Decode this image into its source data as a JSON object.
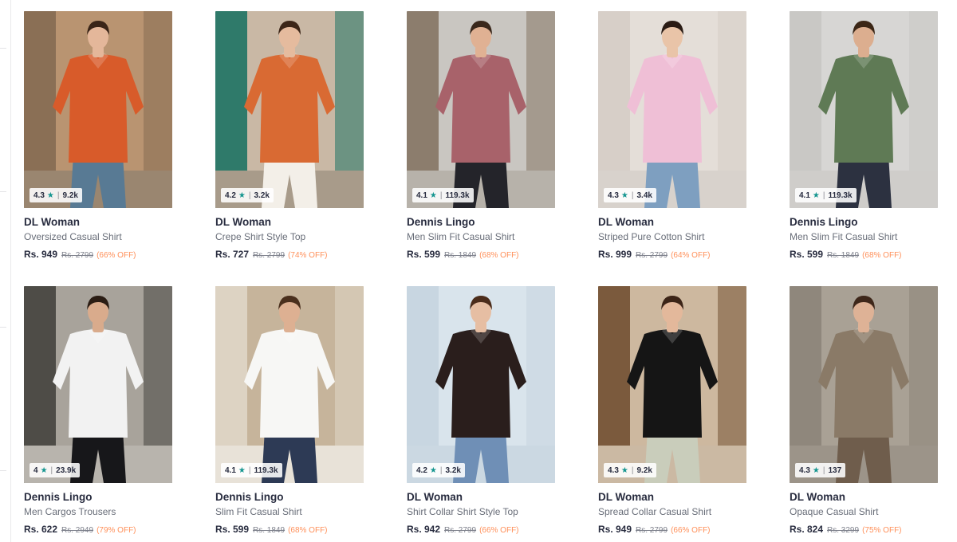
{
  "colors": {
    "star": "#14958f",
    "discount": "#ff905a",
    "text": "#282c3f",
    "muted": "#696e79"
  },
  "products": [
    {
      "rating": "4.3",
      "count": "9.2k",
      "brand": "DL Woman",
      "name": "Oversized Casual Shirt",
      "price": "Rs. 949",
      "mrp": "Rs. 2799",
      "off": "(66% OFF)",
      "art": {
        "bg": "#b99471",
        "bg2": "#8a6f55",
        "garment": "#d85b2a",
        "skin": "#e4b79a",
        "hair": "#3a2518",
        "bottom": "#587a94",
        "floor": "#9a8670"
      }
    },
    {
      "rating": "4.2",
      "count": "3.2k",
      "brand": "DL Woman",
      "name": "Crepe Shirt Style Top",
      "price": "Rs. 727",
      "mrp": "Rs. 2799",
      "off": "(74% OFF)",
      "art": {
        "bg": "#c9b8a5",
        "bg2": "#2f7a6a",
        "garment": "#d96a33",
        "skin": "#e5bb9e",
        "hair": "#3c2618",
        "bottom": "#f3efe8",
        "floor": "#a89b8a"
      }
    },
    {
      "rating": "4.1",
      "count": "119.3k",
      "brand": "Dennis Lingo",
      "name": "Men Slim Fit Casual Shirt",
      "price": "Rs. 599",
      "mrp": "Rs. 1849",
      "off": "(68% OFF)",
      "art": {
        "bg": "#c9c6c1",
        "bg2": "#8c7d6d",
        "garment": "#a8626a",
        "skin": "#e0b193",
        "hair": "#3a281c",
        "bottom": "#24242a",
        "floor": "#b7b2aa"
      }
    },
    {
      "rating": "4.3",
      "count": "3.4k",
      "brand": "DL Woman",
      "name": "Striped Pure Cotton Shirt",
      "price": "Rs. 999",
      "mrp": "Rs. 2799",
      "off": "(64% OFF)",
      "art": {
        "bg": "#e4ded8",
        "bg2": "#d7cfc8",
        "garment": "#efbfd6",
        "skin": "#e9c4a8",
        "hair": "#2a1b14",
        "bottom": "#7e9fc0",
        "floor": "#d8d2cc"
      }
    },
    {
      "rating": "4.1",
      "count": "119.3k",
      "brand": "Dennis Lingo",
      "name": "Men Slim Fit Casual Shirt",
      "price": "Rs. 599",
      "mrp": "Rs. 1849",
      "off": "(68% OFF)",
      "art": {
        "bg": "#d7d6d4",
        "bg2": "#c9c8c5",
        "garment": "#5f7a55",
        "skin": "#dcae8f",
        "hair": "#3b2616",
        "bottom": "#2c3140",
        "floor": "#cfcdca"
      }
    },
    {
      "rating": "4",
      "count": "23.9k",
      "brand": "Dennis Lingo",
      "name": "Men Cargos Trousers",
      "price": "Rs. 622",
      "mrp": "Rs. 2949",
      "off": "(79% OFF)",
      "art": {
        "bg": "#a8a39b",
        "bg2": "#4e4c47",
        "garment": "#17171a",
        "skin": "#d9ab8c",
        "hair": "#2b1d14",
        "bottom": "#17171a",
        "floor": "#b8b4ad",
        "top": "#f2f2f2"
      }
    },
    {
      "rating": "4.1",
      "count": "119.3k",
      "brand": "Dennis Lingo",
      "name": "Slim Fit Casual Shirt",
      "price": "Rs. 599",
      "mrp": "Rs. 1849",
      "off": "(68% OFF)",
      "art": {
        "bg": "#c6b49b",
        "bg2": "#ddd3c3",
        "garment": "#f7f7f5",
        "skin": "#ddb092",
        "hair": "#4a2f1d",
        "bottom": "#2d3a55",
        "floor": "#e8e2d8"
      }
    },
    {
      "rating": "4.2",
      "count": "3.2k",
      "brand": "DL Woman",
      "name": "Shirt Collar Shirt Style Top",
      "price": "Rs. 942",
      "mrp": "Rs. 2799",
      "off": "(66% OFF)",
      "art": {
        "bg": "#d9e4ec",
        "bg2": "#c8d6e1",
        "garment": "#2a1e1c",
        "skin": "#e6bea3",
        "hair": "#4b2c1b",
        "bottom": "#6f8fb6",
        "floor": "#cbd8e2"
      }
    },
    {
      "rating": "4.3",
      "count": "9.2k",
      "brand": "DL Woman",
      "name": "Spread Collar Casual Shirt",
      "price": "Rs. 949",
      "mrp": "Rs. 2799",
      "off": "(66% OFF)",
      "art": {
        "bg": "#cdb89f",
        "bg2": "#7b5a3d",
        "garment": "#151515",
        "skin": "#e3b89b",
        "hair": "#3c2417",
        "bottom": "#c9cdbb",
        "floor": "#cbb9a3"
      }
    },
    {
      "rating": "4.3",
      "count": "137",
      "brand": "DL Woman",
      "name": "Opaque Casual Shirt",
      "price": "Rs. 824",
      "mrp": "Rs. 3299",
      "off": "(75% OFF)",
      "art": {
        "bg": "#a9a195",
        "bg2": "#8f877c",
        "garment": "#8a7a67",
        "skin": "#deb296",
        "hair": "#3e271a",
        "bottom": "#6f5d4c",
        "floor": "#9c9489"
      }
    }
  ]
}
